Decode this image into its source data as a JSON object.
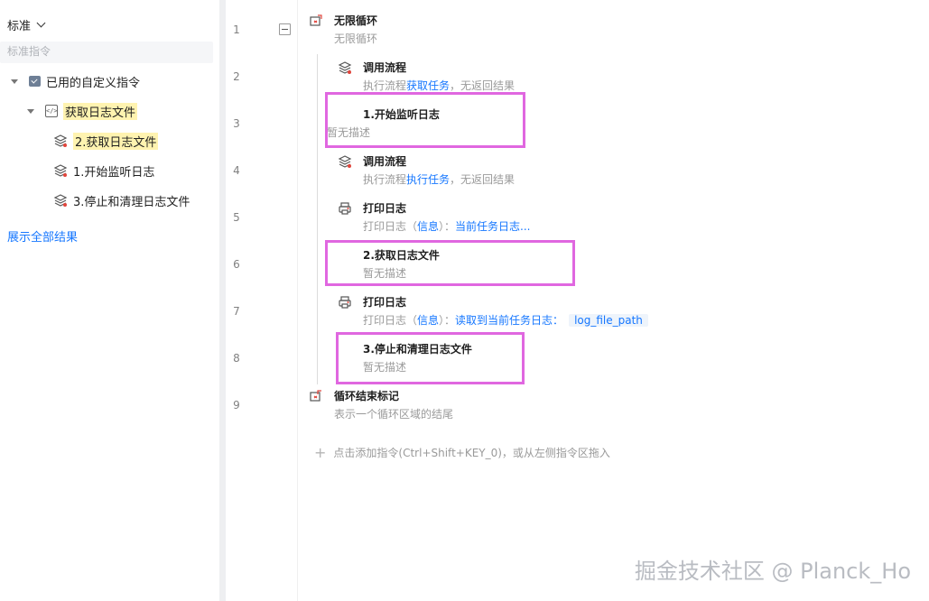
{
  "sidebar": {
    "mode_label": "标准",
    "search_placeholder": "标准指令",
    "tree": {
      "root_label": "已用的自定义指令",
      "group_label": "获取日志文件",
      "items": [
        {
          "label": "2.获取日志文件",
          "highlighted": true
        },
        {
          "label": "1.开始监听日志",
          "highlighted": false
        },
        {
          "label": "3.停止和清理日志文件",
          "highlighted": false
        }
      ]
    },
    "show_all_label": "展示全部结果"
  },
  "editor": {
    "line_numbers": [
      "1",
      "2",
      "3",
      "4",
      "5",
      "6",
      "7",
      "8",
      "9"
    ],
    "lines": [
      {
        "icon": "loop-icon",
        "title": "无限循环",
        "desc": "无限循环"
      },
      {
        "icon": "layers-icon",
        "title": "调用流程",
        "desc_prefix": "执行流程",
        "desc_link": "获取任务",
        "desc_suffix": "，无返回结果"
      },
      {
        "icon": "none",
        "title": "1.开始监听日志",
        "desc": "暂无描述"
      },
      {
        "icon": "layers-icon",
        "title": "调用流程",
        "desc_prefix": "执行流程",
        "desc_link": "执行任务",
        "desc_suffix": "，无返回结果"
      },
      {
        "icon": "printer-icon",
        "title": "打印日志",
        "desc_prefix": "打印日志（",
        "desc_link": "信息",
        "desc_mid": "）：",
        "desc_link2": "当前任务日志..."
      },
      {
        "icon": "none",
        "title": "2.获取日志文件",
        "desc": "暂无描述"
      },
      {
        "icon": "printer-icon",
        "title": "打印日志",
        "desc_prefix": "打印日志（",
        "desc_link": "信息",
        "desc_mid": "）：",
        "desc_link2": "读取到当前任务日志：",
        "desc_var": "log_file_path"
      },
      {
        "icon": "none",
        "title": "3.停止和清理日志文件",
        "desc": "暂无描述"
      },
      {
        "icon": "loop-end-icon",
        "title": "循环结束标记",
        "desc": "表示一个循环区域的结尾"
      }
    ],
    "add_hint": "点击添加指令(Ctrl+Shift+KEY_0)，或从左侧指令区拖入"
  },
  "watermark": "掘金技术社区 @ Planck_Ho",
  "colors": {
    "accent": "#1677ff",
    "highlight_box": "#e067e0",
    "search_highlight": "#fff3b0"
  }
}
